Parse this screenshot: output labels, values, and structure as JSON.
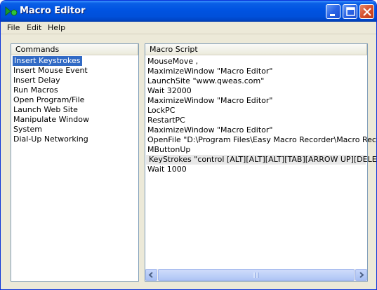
{
  "window": {
    "title": "Macro Editor"
  },
  "menu": {
    "items": [
      "File",
      "Edit",
      "Help"
    ]
  },
  "commands": {
    "header": "Commands",
    "items": [
      "Insert Keystrokes",
      "Insert Mouse Event",
      "Insert Delay",
      "Run Macros",
      "Open Program/File",
      "Launch Web Site",
      "Manipulate Window",
      "System",
      "Dial-Up Networking"
    ],
    "selected_index": 0
  },
  "script": {
    "header": "Macro Script",
    "lines": [
      "MouseMove ,",
      "MaximizeWindow \"Macro Editor\"",
      "LaunchSite \"www.qweas.com\"",
      "Wait 32000",
      "MaximizeWindow \"Macro Editor\"",
      "LockPC",
      "RestartPC",
      "MaximizeWindow \"Macro Editor\"",
      "OpenFile \"D:\\Program Files\\Easy Macro Recorder\\Macro Recor...",
      "MButtonUp",
      "KeyStrokes \"control [ALT][ALT][ALT][TAB][ARROW UP][DELE...",
      "Wait 1000"
    ],
    "highlighted_index": 10
  },
  "colors": {
    "titlebar": "#0053e1",
    "selection": "#316ac5",
    "panel_border": "#7f9db9",
    "window_bg": "#ece9d8"
  }
}
